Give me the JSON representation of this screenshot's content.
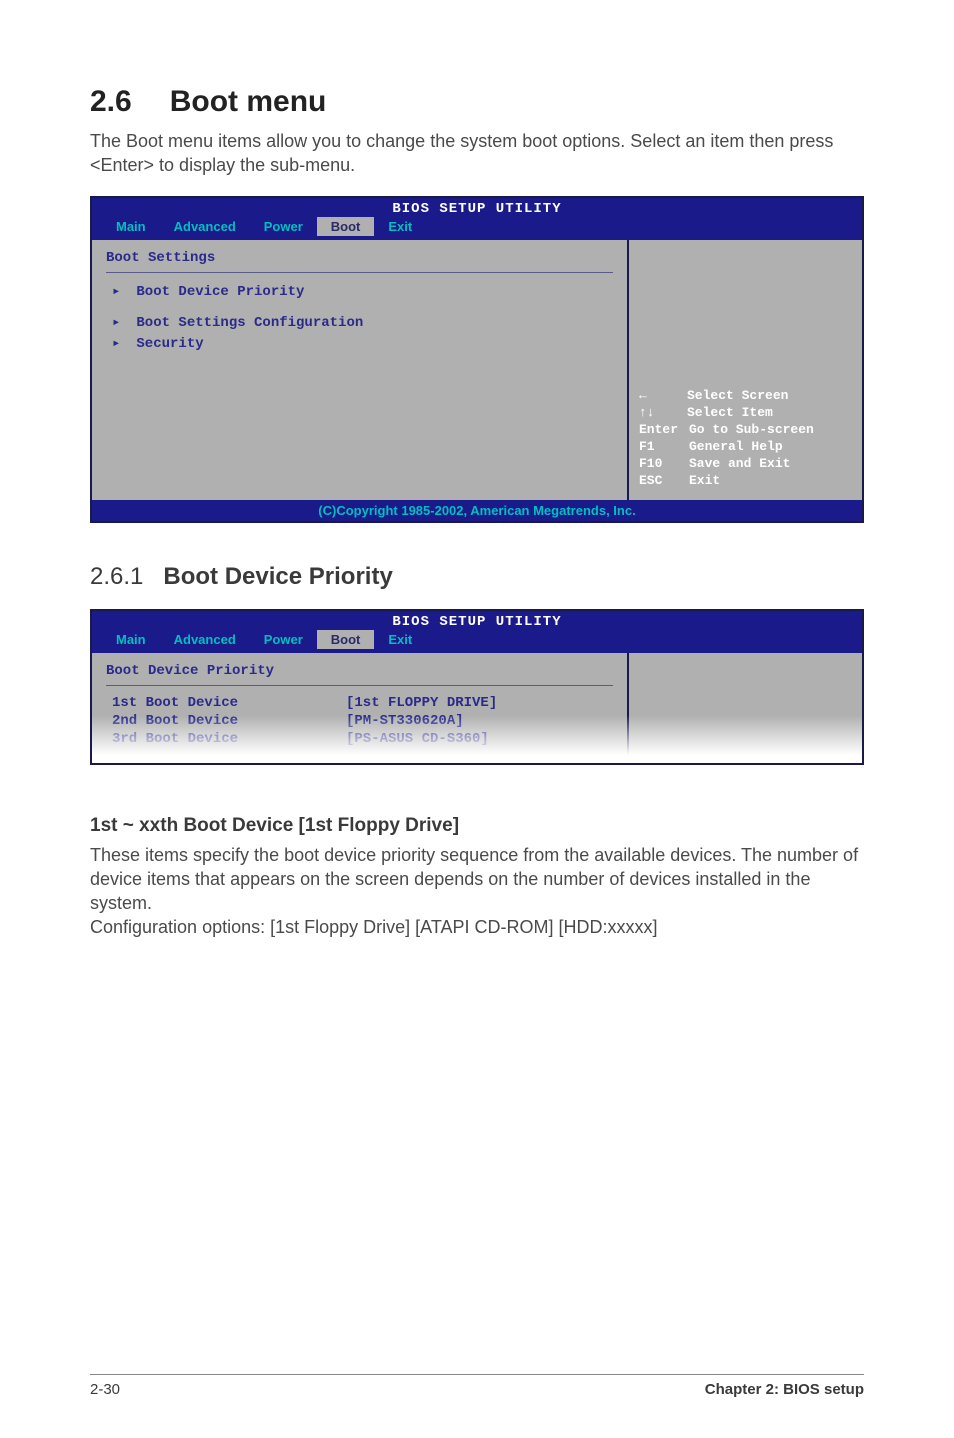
{
  "section": {
    "number": "2.6",
    "title": "Boot menu",
    "intro": "The Boot menu items allow you to change the system boot options. Select an item then press <Enter> to display the sub-menu."
  },
  "bios1": {
    "header": "BIOS SETUP UTILITY",
    "tabs": {
      "main": "Main",
      "advanced": "Advanced",
      "power": "Power",
      "boot": "Boot",
      "exit": "Exit"
    },
    "panel_title": "Boot Settings",
    "items": {
      "priority": "Boot Device Priority",
      "config": "Boot Settings Configuration",
      "security": "Security"
    },
    "help": {
      "select_screen": "Select Screen",
      "select_item": "Select Item",
      "enter_key": "Enter",
      "enter_label": "Go to Sub-screen",
      "f1_key": "F1",
      "f1_label": "General Help",
      "f10_key": "F10",
      "f10_label": "Save and Exit",
      "esc_key": "ESC",
      "esc_label": "Exit"
    },
    "footer": "(C)Copyright 1985-2002, American Megatrends, Inc."
  },
  "subsection": {
    "number": "2.6.1",
    "title": "Boot Device Priority"
  },
  "bios2": {
    "header": "BIOS SETUP UTILITY",
    "tabs": {
      "main": "Main",
      "advanced": "Advanced",
      "power": "Power",
      "boot": "Boot",
      "exit": "Exit"
    },
    "panel_title": "Boot Device Priority",
    "devices": [
      {
        "label": "1st Boot Device",
        "value": "[1st FLOPPY DRIVE]"
      },
      {
        "label": "2nd Boot Device",
        "value": "[PM-ST330620A]"
      },
      {
        "label": "3rd Boot Device",
        "value": "[PS-ASUS CD-S360]"
      }
    ]
  },
  "option": {
    "heading": "1st ~ xxth Boot Device [1st Floppy Drive]",
    "body1": "These items specify the boot device priority sequence from the available devices. The number of device items that appears on the screen depends on the number of devices installed in the system.",
    "body2": "Configuration options:  [1st Floppy Drive] [ATAPI CD-ROM] [HDD:xxxxx]"
  },
  "footer": {
    "page": "2-30",
    "chapter": "Chapter 2: BIOS setup"
  }
}
